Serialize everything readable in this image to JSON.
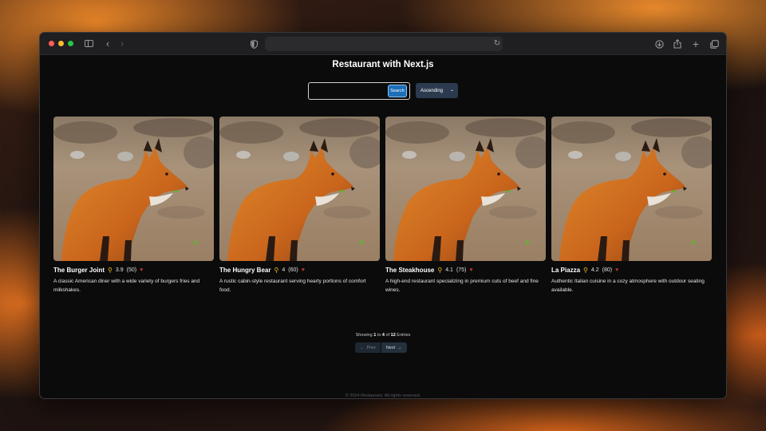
{
  "theme": {
    "accent": "#1d6fb8",
    "pin_color": "#f5c518",
    "heart_color": "#c0392b",
    "select_bg": "#2c3a4f"
  },
  "browser": {
    "traffic_lights": [
      "#ff5f57",
      "#febc2e",
      "#28c840"
    ],
    "url": "",
    "icons": [
      "sidebar-icon",
      "back-icon",
      "forward-icon",
      "shield-icon",
      "reload-icon",
      "download-icon",
      "share-icon",
      "new-tab-icon",
      "tabs-overview-icon"
    ]
  },
  "page": {
    "title": "Restaurant with Next.js",
    "search": {
      "value": "",
      "button": "Search"
    },
    "sort": {
      "selected": "Ascending"
    }
  },
  "restaurants": [
    {
      "name": "The Burger Joint",
      "rating": "3.9",
      "reviews": "(50)",
      "description": "A classic American diner with a wide variety of burgers fries and milkshakes."
    },
    {
      "name": "The Hungry Bear",
      "rating": "4",
      "reviews": "(60)",
      "description": "A rustic cabin-style restaurant serving hearty portions of comfort food."
    },
    {
      "name": "The Steakhouse",
      "rating": "4.1",
      "reviews": "(75)",
      "description": "A high-end restaurant specializing in premium cuts of beef and fine wines."
    },
    {
      "name": "La Piazza",
      "rating": "4.2",
      "reviews": "(80)",
      "description": "Authentic Italian cuisine in a cozy atmosphere with outdoor seating available."
    }
  ],
  "pagination": {
    "showing_prefix": "Showing",
    "from": "1",
    "to_word": "to",
    "to": "4",
    "of_word": "of",
    "total": "12",
    "entries_word": "Entries",
    "prev": "Prev",
    "next": "Next"
  },
  "footer": "© 2024 Restaurant. All rights reserved."
}
